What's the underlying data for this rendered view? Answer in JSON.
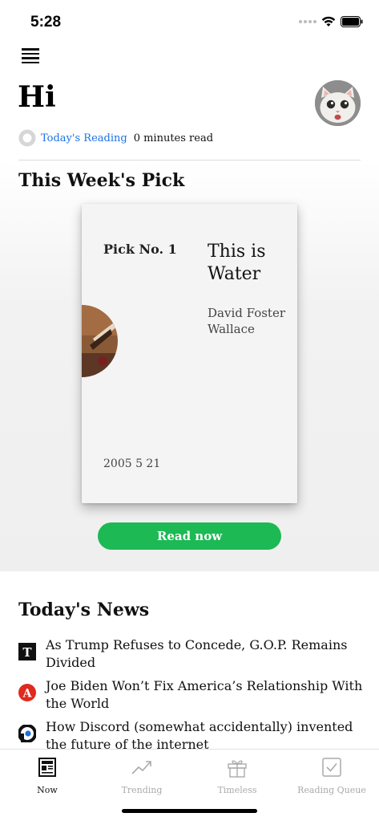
{
  "status_bar": {
    "time": "5:28"
  },
  "header": {
    "greeting": "Hi",
    "reading_link": "Today's Reading",
    "reading_meta": "0 minutes read"
  },
  "weekly_pick": {
    "section_title": "This Week's Pick",
    "pick_number": "Pick No. 1",
    "book_title": "This is Water",
    "author": "David Foster Wallace",
    "date": "2005 5 21",
    "button_label": "Read now",
    "button_color": "#1db954"
  },
  "news": {
    "section_title": "Today's News",
    "items": [
      {
        "source_icon": "nyt-logo-icon",
        "headline": "As Trump Refuses to Concede, G.O.P. Remains Divided"
      },
      {
        "source_icon": "atlantic-logo-icon",
        "headline": "Joe Biden Won’t Fix America’s Relationship With the World"
      },
      {
        "source_icon": "p-logo-icon",
        "headline": "How Discord (somewhat accidentally) invented the future of the internet"
      }
    ]
  },
  "tabs": [
    {
      "label": "Now",
      "icon": "newspaper-icon",
      "active": true
    },
    {
      "label": "Trending",
      "icon": "trending-icon",
      "active": false
    },
    {
      "label": "Timeless",
      "icon": "gift-icon",
      "active": false
    },
    {
      "label": "Reading Queue",
      "icon": "checkbox-icon",
      "active": false
    }
  ],
  "colors": {
    "link": "#1a73e8",
    "accent_green": "#1db954"
  }
}
